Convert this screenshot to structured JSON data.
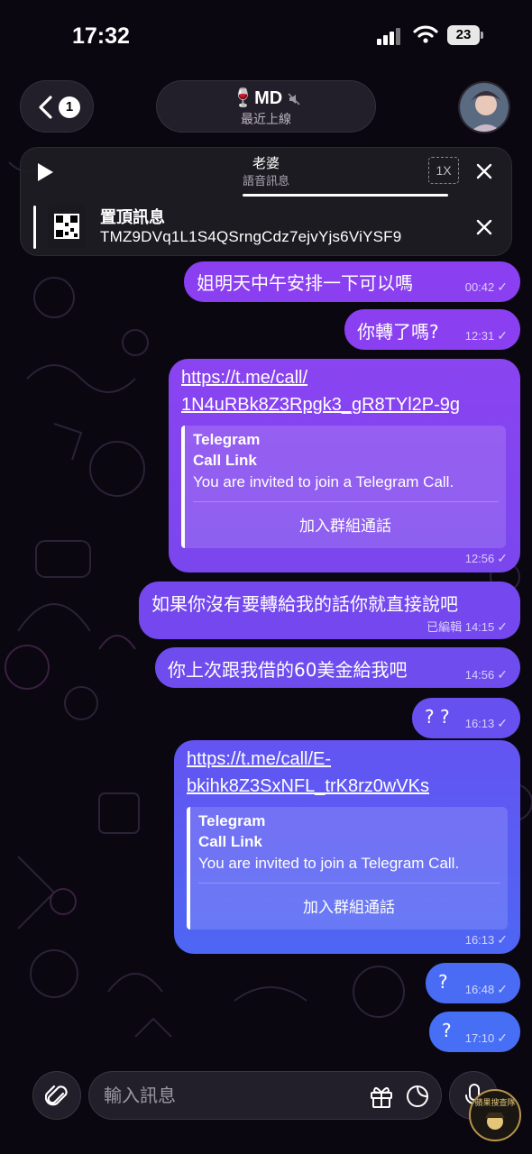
{
  "status_bar": {
    "time": "17:32",
    "battery": "23"
  },
  "header": {
    "back_badge": "1",
    "contact_name": "🍷MD",
    "last_seen": "最近上線"
  },
  "audio": {
    "title": "老婆",
    "subtitle": "語音訊息",
    "speed": "1X"
  },
  "pinned": {
    "label": "置頂訊息",
    "text": "TMZ9DVq1L1S4QSrngCdz7ejvYjs6ViYSF9"
  },
  "messages": [
    {
      "text": "姐明天中午安排一下可以嗎",
      "time": "00:42"
    },
    {
      "text": "你轉了嗎?",
      "time": "12:31"
    },
    {
      "link_line1": "https://t.me/call/",
      "link_line2": "1N4uRBk8Z3Rpgk3_gR8TYl2P-9g",
      "preview_site": "Telegram",
      "preview_title": "Call Link",
      "preview_desc": "You are invited to join a Telegram Call.",
      "button": "加入群組通話",
      "time": "12:56"
    },
    {
      "text": "如果你沒有要轉給我的話你就直接說吧",
      "edited": "已編輯",
      "time": "14:15"
    },
    {
      "text": "你上次跟我借的60美金給我吧",
      "time": "14:56"
    },
    {
      "text": "? ?",
      "time": "16:13"
    },
    {
      "link_line1": "https://t.me/call/E-",
      "link_line2": "bkihk8Z3SxNFL_trK8rz0wVKs",
      "preview_site": "Telegram",
      "preview_title": "Call Link",
      "preview_desc": "You are invited to join a Telegram Call.",
      "button": "加入群組通話",
      "time": "16:13"
    },
    {
      "text": "?",
      "time": "16:48"
    },
    {
      "text": "?",
      "time": "17:10"
    }
  ],
  "composer": {
    "placeholder": "輸入訊息"
  },
  "watermark": {
    "text": "蘋果搜查隊"
  },
  "colors": {
    "bubble_top": "#8a3ff0",
    "bubble_bottom": "#4a6cf5",
    "panel_bg": "#1e1c23",
    "wallpaper": "#0a0710"
  },
  "icons": [
    "back-chevron-icon",
    "play-icon",
    "close-icon",
    "qr-code-icon",
    "paperclip-icon",
    "gift-icon",
    "sticker-icon",
    "mic-icon",
    "mute-icon",
    "signal-icon",
    "wifi-icon",
    "checkmark-icon"
  ]
}
